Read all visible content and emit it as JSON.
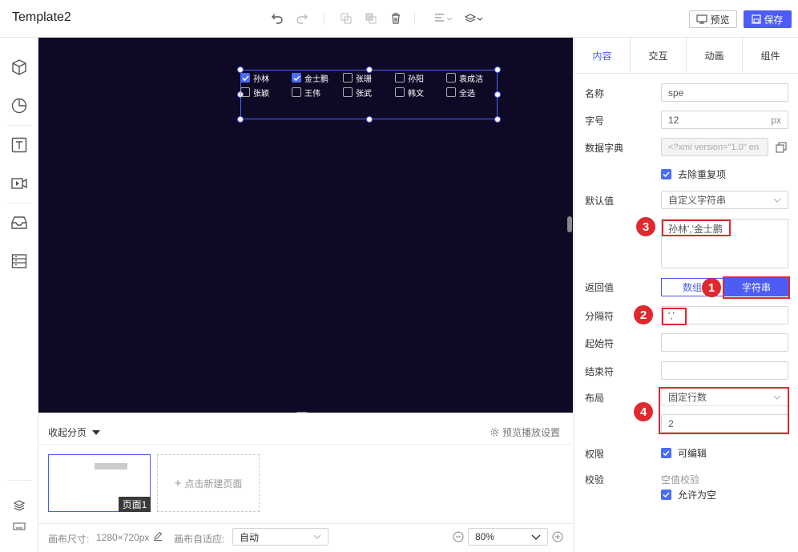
{
  "app": {
    "title": "Template2"
  },
  "toolbar": {
    "preview_label": "预览",
    "save_label": "保存"
  },
  "canvas": {
    "checkbox_row1": [
      {
        "label": "孙林",
        "checked": true
      },
      {
        "label": "金士鹏",
        "checked": true
      },
      {
        "label": "张珊",
        "checked": false
      },
      {
        "label": "孙阳",
        "checked": false
      },
      {
        "label": "袁成洁",
        "checked": false
      }
    ],
    "checkbox_row2": [
      {
        "label": "张颖",
        "checked": false
      },
      {
        "label": "王伟",
        "checked": false
      },
      {
        "label": "张武",
        "checked": false
      },
      {
        "label": "韩文",
        "checked": false
      },
      {
        "label": "全选",
        "checked": false
      }
    ]
  },
  "pages": {
    "collapse_label": "收起分页",
    "preview_settings_label": "预览播放设置",
    "page1_label": "页面1",
    "new_page_label": "点击新建页面"
  },
  "footer": {
    "canvas_size_label": "画布尺寸:",
    "canvas_size_value": "1280×720px",
    "autofit_label": "画布自适应:",
    "autofit_value": "自动",
    "zoom_value": "80%"
  },
  "panel": {
    "tabs": [
      "内容",
      "交互",
      "动画",
      "组件"
    ],
    "active_tab": "内容",
    "name_label": "名称",
    "name_value": "spe",
    "fontsize_label": "字号",
    "fontsize_value": "12",
    "fontsize_unit": "px",
    "dict_label": "数据字典",
    "dict_value": "<?xml version=\"1.0\" en",
    "dedupe_label": "去除重复项",
    "default_label": "默认值",
    "default_type": "自定义字符串",
    "default_value": "孙林','金士鹏",
    "return_label": "返回值",
    "return_opt_array": "数组",
    "return_opt_string": "字符串",
    "separator_label": "分隔符",
    "separator_value": "','",
    "start_label": "起始符",
    "end_label": "结束符",
    "layout_label": "布局",
    "layout_type": "固定行数",
    "layout_rows": "2",
    "permission_label": "权限",
    "editable_label": "可编辑",
    "validate_label": "校验",
    "empty_check_label": "空值校验",
    "allow_empty_label": "允许为空"
  },
  "annotations": [
    "1",
    "2",
    "3",
    "4"
  ],
  "colors": {
    "accent": "#4d5cf2",
    "canvas_bg": "#0e0a25",
    "annotation_red": "#e0282e"
  }
}
